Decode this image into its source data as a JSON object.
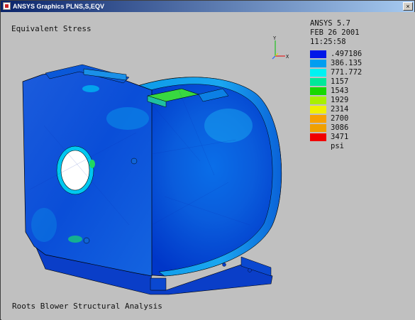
{
  "window": {
    "title": "ANSYS Graphics   PLNS,S,EQV",
    "close_glyph": "×"
  },
  "plot": {
    "title": "Equivalent Stress",
    "footer": "Roots Blower Structural Analysis"
  },
  "info": {
    "version": "ANSYS 5.7",
    "date": "FEB 26 2001",
    "time": "11:25:58"
  },
  "triad": {
    "x_label": "X",
    "y_label": "Y"
  },
  "legend": {
    "unit": "psi",
    "items": [
      {
        "label": ".497186",
        "color": "#0018e8"
      },
      {
        "label": "386.135",
        "color": "#009ef0"
      },
      {
        "label": "771.772",
        "color": "#00f2f2"
      },
      {
        "label": "1157",
        "color": "#00e89a"
      },
      {
        "label": "1543",
        "color": "#18d800"
      },
      {
        "label": "1929",
        "color": "#a8f000"
      },
      {
        "label": "2314",
        "color": "#f0f000"
      },
      {
        "label": "2700",
        "color": "#f8a000"
      },
      {
        "label": "3086",
        "color": "#f0a000"
      },
      {
        "label": "3471",
        "color": "#f00000"
      }
    ]
  }
}
